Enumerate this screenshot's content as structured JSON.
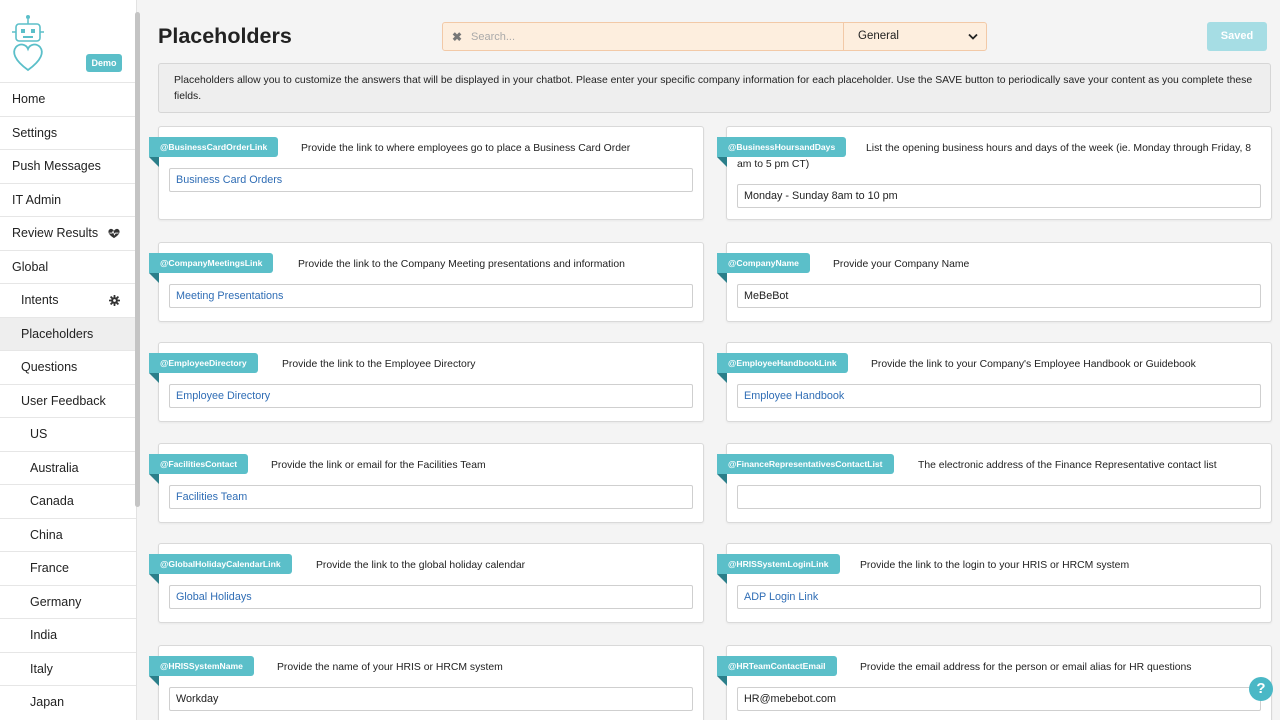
{
  "sidebar": {
    "demo_badge": "Demo",
    "items": [
      {
        "label": "Home"
      },
      {
        "label": "Settings"
      },
      {
        "label": "Push Messages"
      },
      {
        "label": "IT Admin"
      },
      {
        "label": "Review Results"
      },
      {
        "label": "Global"
      },
      {
        "label": "Intents"
      },
      {
        "label": "Placeholders"
      },
      {
        "label": "Questions"
      },
      {
        "label": "User Feedback"
      },
      {
        "label": "US"
      },
      {
        "label": "Australia"
      },
      {
        "label": "Canada"
      },
      {
        "label": "China"
      },
      {
        "label": "France"
      },
      {
        "label": "Germany"
      },
      {
        "label": "India"
      },
      {
        "label": "Italy"
      },
      {
        "label": "Japan"
      }
    ]
  },
  "header": {
    "title": "Placeholders",
    "search_placeholder": "Search...",
    "category_selected": "General",
    "saved_label": "Saved"
  },
  "info_text": "Placeholders allow you to customize the answers that will be displayed in your chatbot. Please enter your specific company information for each placeholder. Use the SAVE button to periodically save your content as you complete these fields.",
  "cards": [
    {
      "tag": "@BusinessCardOrderLink",
      "desc": "Provide the link to where employees go to place a Business Card Order",
      "value": "Business Card Orders"
    },
    {
      "tag": "@BusinessHoursandDays",
      "desc": "List the opening business hours and days of the week (ie. Monday through Friday, 8 am to 5 pm CT)",
      "value": "Monday - Sunday  8am to  10 pm"
    },
    {
      "tag": "@CompanyMeetingsLink",
      "desc": "Provide the link to the Company Meeting presentations and information",
      "value": "Meeting Presentations"
    },
    {
      "tag": "@CompanyName",
      "desc": "Provide your Company Name",
      "value": "MeBeBot"
    },
    {
      "tag": "@EmployeeDirectory",
      "desc": "Provide the link to the Employee Directory",
      "value": "Employee Directory"
    },
    {
      "tag": "@EmployeeHandbookLink",
      "desc": "Provide the link to your Company's Employee Handbook or Guidebook",
      "value": "Employee Handbook"
    },
    {
      "tag": "@FacilitiesContact",
      "desc": "Provide the link or email for the Facilities Team",
      "value": "Facilities Team"
    },
    {
      "tag": "@FinanceRepresentativesContactList",
      "desc": "The electronic address of the Finance Representative contact list",
      "value": ""
    },
    {
      "tag": "@GlobalHolidayCalendarLink",
      "desc": "Provide the link to the global holiday calendar",
      "value": "Global Holidays"
    },
    {
      "tag": "@HRISSystemLoginLink",
      "desc": "Provide the link to the login to your HRIS or HRCM system",
      "value": "ADP Login Link"
    },
    {
      "tag": "@HRISSystemName",
      "desc": "Provide the name of your HRIS or HRCM system",
      "value": "Workday"
    },
    {
      "tag": "@HRTeamContactEmail",
      "desc": "Provide the email address for the person or email alias for HR questions",
      "value": "HR@mebebot.com"
    }
  ],
  "help_label": "?",
  "colors": {
    "accent": "#5bbfc9",
    "link": "#2f6db5",
    "search_bg": "#fdeede",
    "saved_bg": "#a6dde4"
  }
}
